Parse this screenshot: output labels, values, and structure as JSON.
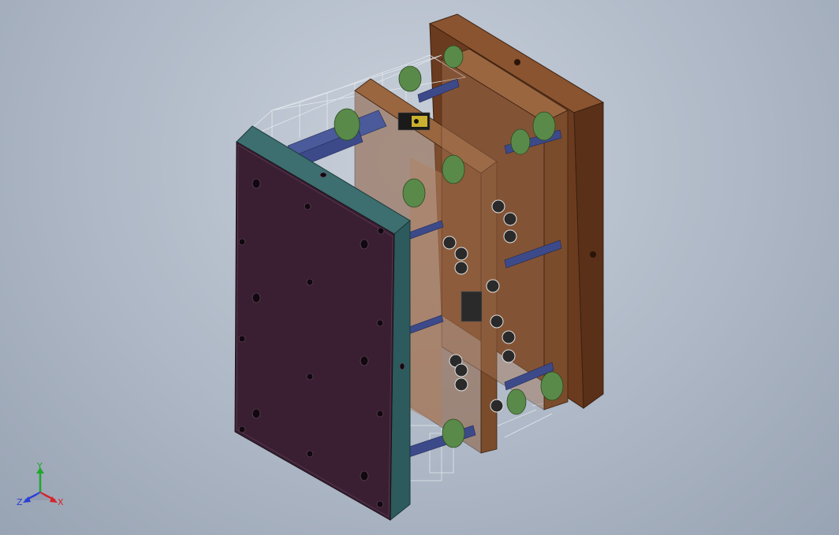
{
  "viewport": {
    "background_top": "#c8d0da",
    "background_bottom": "#98a3b3"
  },
  "model": {
    "colors": {
      "clamp_plate": "#3a1f33",
      "clamp_plate_edge": "#2d5a5c",
      "back_plate": "#6b3b1f",
      "back_plate_side": "#8a5430",
      "mold_plate": "#8b5a3a",
      "guide_pin": "#3c4a8a",
      "bushing": "#5a8a4a",
      "fitting": "#2a2a2a",
      "wireframe": "#e8ecf2"
    }
  },
  "triad": {
    "y_label": "Y",
    "x_label": "X",
    "z_label": "Z",
    "y_color": "#1fa82a",
    "x_color": "#d6232a",
    "z_color": "#2a3fd6"
  }
}
